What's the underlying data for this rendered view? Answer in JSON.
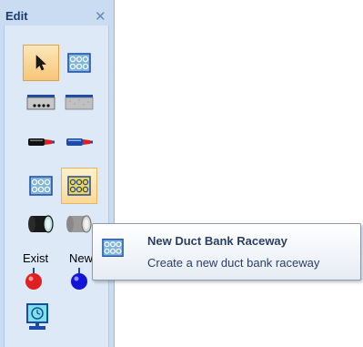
{
  "panel": {
    "title": "Edit",
    "close_glyph": "✕",
    "tools": [
      {
        "id": "select",
        "icon": "arrow-pointer-icon",
        "state": "selected"
      },
      {
        "id": "duct-bank-grid",
        "icon": "duct-bank-grid-icon",
        "state": "normal"
      },
      {
        "id": "dotted-trench",
        "icon": "dotted-trench-icon",
        "state": "normal"
      },
      {
        "id": "flat-trench",
        "icon": "flat-trench-icon",
        "state": "normal"
      },
      {
        "id": "cable-red",
        "icon": "cable-red-tip-icon",
        "state": "normal"
      },
      {
        "id": "cable-blue",
        "icon": "cable-blue-tip-icon",
        "state": "normal"
      },
      {
        "id": "duct-bank-raceway",
        "icon": "duct-bank-raceway-icon",
        "state": "normal"
      },
      {
        "id": "new-duct-bank-raceway",
        "icon": "new-duct-bank-raceway-icon",
        "state": "hover"
      },
      {
        "id": "conduit-dark",
        "icon": "conduit-dark-icon",
        "state": "normal"
      },
      {
        "id": "conduit-light",
        "icon": "conduit-light-icon",
        "state": "normal"
      },
      {
        "id": "exist-marker",
        "icon": "red-ball-icon",
        "state": "normal"
      },
      {
        "id": "new-marker",
        "icon": "blue-ball-icon",
        "state": "normal"
      },
      {
        "id": "monitor",
        "icon": "monitor-icon",
        "state": "normal"
      }
    ],
    "labels": {
      "exist": "Exist",
      "new": "New"
    }
  },
  "tooltip": {
    "title": "New Duct Bank Raceway",
    "description": "Create a new duct bank raceway"
  },
  "colors": {
    "panel_bg": "#c9dcf2",
    "selected_bg": "#f6c678",
    "accent_blue": "#1c4aa8",
    "red": "#e02020"
  }
}
